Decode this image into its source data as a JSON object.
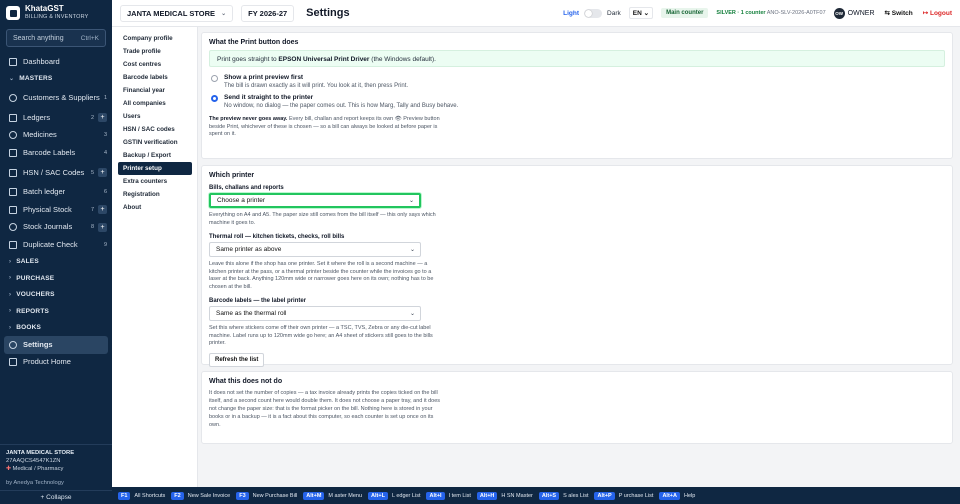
{
  "brand": {
    "name": "KhataGST",
    "subtitle": "BILLING & INVENTORY"
  },
  "search": {
    "placeholder": "Search anything",
    "shortcut": "Ctrl+K"
  },
  "sidebar": {
    "items": [
      {
        "label": "Dashboard"
      },
      {
        "section": "MASTERS"
      },
      {
        "label": "Customers & Suppliers",
        "count": "1"
      },
      {
        "label": "Ledgers",
        "count": "2"
      },
      {
        "label": "Medicines",
        "count": "3"
      },
      {
        "label": "Barcode Labels",
        "count": "4"
      },
      {
        "label": "HSN / SAC Codes",
        "count": "5"
      },
      {
        "label": "Batch ledger",
        "count": "6"
      },
      {
        "label": "Physical Stock",
        "count": "7"
      },
      {
        "label": "Stock Journals",
        "count": "8"
      },
      {
        "label": "Duplicate Check",
        "count": "9"
      },
      {
        "section": "SALES"
      },
      {
        "section": "PURCHASE"
      },
      {
        "section": "VOUCHERS"
      },
      {
        "section": "REPORTS"
      },
      {
        "section": "BOOKS"
      },
      {
        "label": "Settings"
      },
      {
        "label": "Product Home"
      }
    ],
    "footer": {
      "company": "JANTA MEDICAL STORE",
      "gstin": "27AAQCS4547K1ZN",
      "type": "Medical / Pharmacy",
      "by": "by Anedya Technology",
      "collapse": "+ Collapse"
    }
  },
  "topbar": {
    "company": "JANTA MEDICAL STORE",
    "fy": "FY 2026-27",
    "title": "Settings",
    "theme_light": "Light",
    "theme_dark": "Dark",
    "lang": "EN",
    "counter": "Main counter",
    "license_label": "SILVER · 1 counter",
    "license_key": "ANO-SLV-2026-A0TF07",
    "avatar": "OW",
    "role": "OWNER",
    "switch": "⇆ Switch",
    "logout": "↦ Logout"
  },
  "subnav": [
    "Company profile",
    "Trade profile",
    "Cost centres",
    "Barcode labels",
    "Financial year",
    "All companies",
    "Users",
    "HSN / SAC codes",
    "GSTIN verification",
    "Backup / Export",
    "Printer setup",
    "Extra counters",
    "Registration",
    "About"
  ],
  "print_button": {
    "heading": "What the Print button does",
    "banner_pre": "Print goes straight to ",
    "banner_driver": "EPSON Universal Print Driver",
    "banner_post": " (the Windows default).",
    "option1_title": "Show a print preview first",
    "option1_desc": "The bill is drawn exactly as it will print. You look at it, then press Print.",
    "option2_title": "Send it straight to the printer",
    "option2_desc": "No window, no dialog — the paper comes out. This is how Marg, Tally and Busy behave.",
    "note_bold": "The preview never goes away.",
    "note_text": " Every bill, challan and report keeps its own 👁 Preview button beside Print, whichever of these is chosen — so a bill can always be looked at before paper is spent on it."
  },
  "which_printer": {
    "heading": "Which printer",
    "bills_label": "Bills, challans and reports",
    "bills_value": "Choose a printer",
    "bills_hint": "Everything on A4 and A5. The paper size still comes from the bill itself — this only says which machine it goes to.",
    "thermal_label": "Thermal roll — kitchen tickets, checks, roll bills",
    "thermal_value": "Same printer as above",
    "thermal_hint": "Leave this alone if the shop has one printer. Set it where the roll is a second machine — a kitchen printer at the pass, or a thermal printer beside the counter while the invoices go to a laser at the back. Anything 120mm wide or narrower goes here on its own; nothing has to be chosen at the bill.",
    "barcode_label": "Barcode labels — the label printer",
    "barcode_value": "Same as the thermal roll",
    "barcode_hint": "Set this where stickers come off their own printer — a TSC, TVS, Zebra or any die-cut label machine. Label runs up to 120mm wide go here; an A4 sheet of stickers still goes to the bills printer.",
    "refresh": "Refresh the list"
  },
  "not_do": {
    "heading": "What this does not do",
    "text": "It does not set the number of copies — a tax invoice already prints the copies ticked on the bill itself, and a second count here would double them. It does not choose a paper tray, and it does not change the paper size: that is the format picker on the bill. Nothing here is stored in your books or in a backup — it is a fact about this computer, so each counter is set up once on its own."
  },
  "shortcuts": [
    {
      "key": "F1",
      "label": "All Shortcuts"
    },
    {
      "key": "F2",
      "label": "New Sale Invoice"
    },
    {
      "key": "F3",
      "label": "New Purchase Bill"
    },
    {
      "key": "Alt+M",
      "label": "M aster Menu"
    },
    {
      "key": "Alt+L",
      "label": "L edger List"
    },
    {
      "key": "Alt+I",
      "label": "I tem List"
    },
    {
      "key": "Alt+H",
      "label": "H SN Master"
    },
    {
      "key": "Alt+S",
      "label": "S ales List"
    },
    {
      "key": "Alt+P",
      "label": "P urchase List"
    },
    {
      "key": "Alt+A",
      "label": "Help"
    }
  ],
  "colors": {
    "sidebar_bg": "#0f2742",
    "accent": "#2563eb",
    "focus": "#22c55e",
    "logout": "#dc2626"
  }
}
